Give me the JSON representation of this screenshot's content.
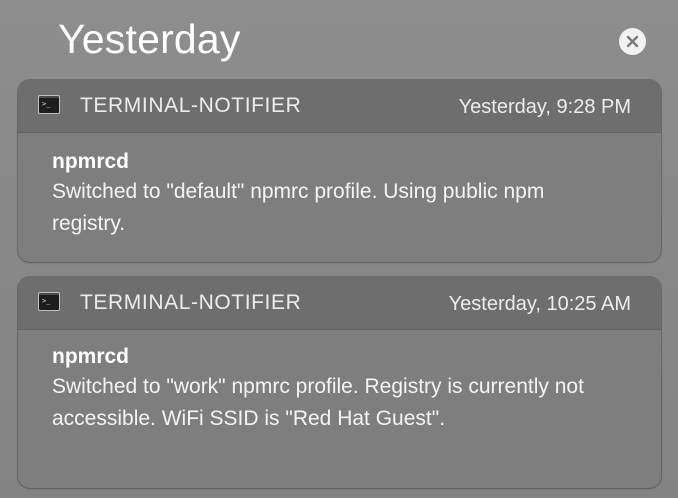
{
  "section": {
    "title": "Yesterday",
    "clear_icon": "close-icon"
  },
  "notifications": [
    {
      "app_icon": "terminal-icon",
      "app_name": "TERMINAL-NOTIFIER",
      "time": "Yesterday, 9:28 PM",
      "title": "npmrcd",
      "message": "Switched to \"default\" npmrc profile. Using public npm registry."
    },
    {
      "app_icon": "terminal-icon",
      "app_name": "TERMINAL-NOTIFIER",
      "time": "Yesterday, 10:25 AM",
      "title": "npmrcd",
      "message": "Switched to \"work\" npmrc profile. Registry is currently not accessible. WiFi SSID is \"Red Hat Guest\"."
    }
  ]
}
